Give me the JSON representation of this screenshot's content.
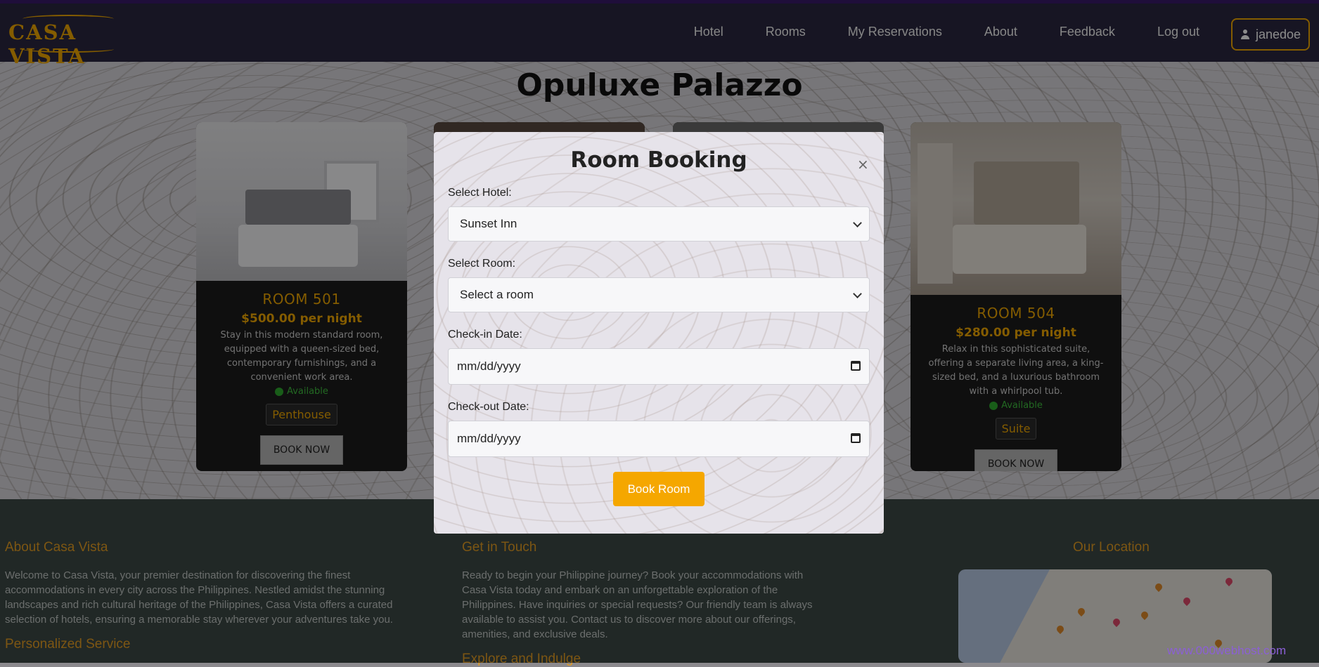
{
  "navbar": {
    "logo_text": "CASA VISTA",
    "links": [
      "Hotel",
      "Rooms",
      "My Reservations",
      "About",
      "Feedback",
      "Log out"
    ],
    "user_label": "janedoe"
  },
  "main": {
    "hotel_title": "Opuluxe Palazzo",
    "rooms": [
      {
        "name": "ROOM 501",
        "price": "$500.00 per night",
        "description": "Stay in this modern standard room, equipped with a queen-sized bed, contemporary furnishings, and a convenient work area.",
        "status": "Available",
        "type": "Penthouse",
        "book_label": "BOOK NOW"
      },
      {
        "name": "ROOM 504",
        "price": "$280.00 per night",
        "description": "Relax in this sophisticated suite, offering a separate living area, a king-sized bed, and a luxurious bathroom with a whirlpool tub.",
        "status": "Available",
        "type": "Suite",
        "book_label": "BOOK NOW"
      }
    ]
  },
  "modal": {
    "title": "Room Booking",
    "close_symbol": "×",
    "hotel_label": "Select Hotel:",
    "hotel_value": "Sunset Inn",
    "room_label": "Select Room:",
    "room_value": "Select a room",
    "checkin_label": "Check-in Date:",
    "checkin_value": "mm/dd/yyyy",
    "checkout_label": "Check-out Date:",
    "checkout_value": "mm/dd/yyyy",
    "submit_label": "Book Room"
  },
  "footer": {
    "about_heading": "About Casa Vista",
    "about_text": "Welcome to Casa Vista, your premier destination for discovering the finest accommodations in every city across the Philippines. Nestled amidst the stunning landscapes and rich cultural heritage of the Philippines, Casa Vista offers a curated selection of hotels, ensuring a memorable stay wherever your adventures take you.",
    "about_sub": "Personalized Service",
    "contact_heading": "Get in Touch",
    "contact_text": "Ready to begin your Philippine journey? Book your accommodations with Casa Vista today and embark on an unforgettable exploration of the Philippines. Have inquiries or special requests? Our friendly team is always available to assist you. Contact us to discover more about our offerings, amenities, and exclusive deals.",
    "contact_sub": "Explore and Indulge",
    "location_heading": "Our Location",
    "watermark": "www.000webhost.com"
  },
  "colors": {
    "accent": "#f0a800",
    "navbar_bg": "#2a2740",
    "footer_bg": "#3c4a46",
    "status_green": "#2faa2f"
  }
}
